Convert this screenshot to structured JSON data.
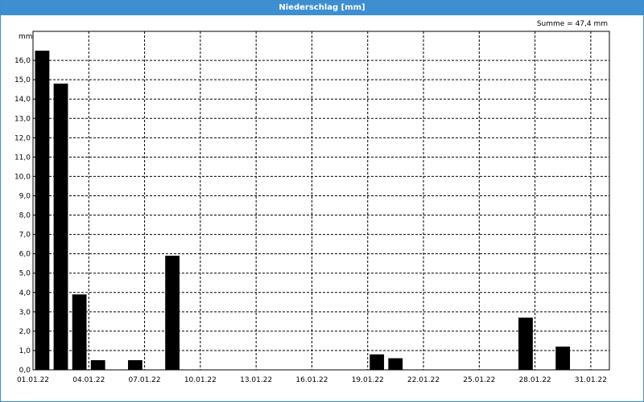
{
  "window": {
    "title": "Niederschlag [mm]"
  },
  "summary": {
    "text": "Summe = 47,4 mm"
  },
  "chart_data": {
    "type": "bar",
    "title": "Niederschlag [mm]",
    "ylabel": "mm",
    "ylim": [
      0,
      17.5
    ],
    "y_ticks": [
      "0,0",
      "1,0",
      "2,0",
      "3,0",
      "4,0",
      "5,0",
      "6,0",
      "7,0",
      "8,0",
      "9,0",
      "10,0",
      "11,0",
      "12,0",
      "13,0",
      "14,0",
      "15,0",
      "16,0"
    ],
    "x_ticks": [
      "01.01.22",
      "04.01.22",
      "07.01.22",
      "10.01.22",
      "13.01.22",
      "16.01.22",
      "19.01.22",
      "22.01.22",
      "25.01.22",
      "28.01.22",
      "31.01.22"
    ],
    "grid": true,
    "bar_color": "#000000",
    "series": [
      {
        "values": [
          {
            "date": "01.01.22",
            "value": 16.5
          },
          {
            "date": "02.01.22",
            "value": 14.8
          },
          {
            "date": "03.01.22",
            "value": 3.9
          },
          {
            "date": "04.01.22",
            "value": 0.5
          },
          {
            "date": "06.01.22",
            "value": 0.5
          },
          {
            "date": "08.01.22",
            "value": 5.9
          },
          {
            "date": "19.01.22",
            "value": 0.8
          },
          {
            "date": "20.01.22",
            "value": 0.6
          },
          {
            "date": "27.01.22",
            "value": 2.7
          },
          {
            "date": "29.01.22",
            "value": 1.2
          }
        ]
      }
    ]
  }
}
